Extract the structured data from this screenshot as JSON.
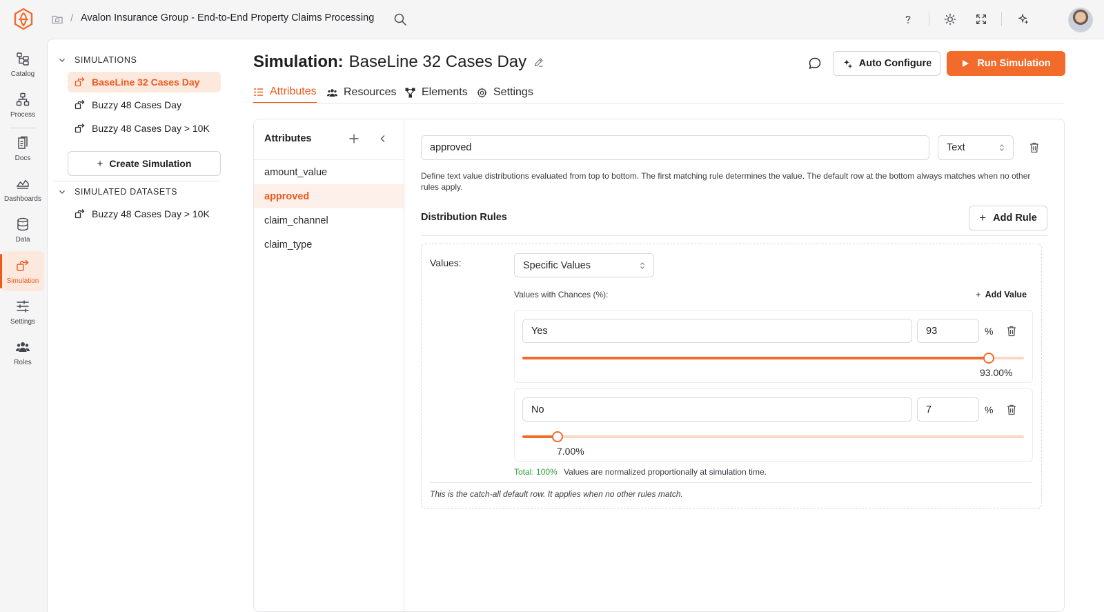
{
  "header": {
    "breadcrumb_title": "Avalon Insurance Group - End-to-End Property Claims Processing",
    "separator": "/"
  },
  "nav": {
    "items": [
      {
        "label": "Catalog",
        "icon": "catalog-icon"
      },
      {
        "label": "Process",
        "icon": "process-icon"
      },
      {
        "label": "Docs",
        "icon": "docs-icon"
      },
      {
        "label": "Dashboards",
        "icon": "dashboards-icon"
      },
      {
        "label": "Data",
        "icon": "database-icon"
      },
      {
        "label": "Simulation",
        "icon": "simulation-icon",
        "active": true
      },
      {
        "label": "Settings",
        "icon": "sliders-icon"
      },
      {
        "label": "Roles",
        "icon": "users-icon"
      }
    ]
  },
  "sidebar": {
    "simulations_heading": "SIMULATIONS",
    "simulations": [
      {
        "label": "BaseLine 32 Cases Day",
        "active": true
      },
      {
        "label": "Buzzy 48 Cases Day"
      },
      {
        "label": "Buzzy 48 Cases Day > 10K"
      }
    ],
    "create_button": "Create Simulation",
    "datasets_heading": "SIMULATED DATASETS",
    "datasets": [
      {
        "label": "Buzzy 48 Cases Day > 10K"
      }
    ]
  },
  "main": {
    "title_prefix": "Simulation:",
    "title_name": "BaseLine 32 Cases Day",
    "auto_configure": "Auto Configure",
    "run_simulation": "Run Simulation",
    "tabs": [
      {
        "label": "Attributes",
        "active": true
      },
      {
        "label": "Resources"
      },
      {
        "label": "Elements"
      },
      {
        "label": "Settings"
      }
    ]
  },
  "attributes": {
    "heading": "Attributes",
    "items": [
      {
        "label": "amount_value"
      },
      {
        "label": "approved",
        "active": true
      },
      {
        "label": "claim_channel"
      },
      {
        "label": "claim_type"
      }
    ]
  },
  "detail": {
    "name_value": "approved",
    "type_value": "Text",
    "description": "Define text value distributions evaluated from top to bottom. The first matching rule determines the value. The default row at the bottom always matches when no other rules apply.",
    "rules_heading": "Distribution Rules",
    "add_rule": "Add Rule",
    "values_label": "Values:",
    "values_mode": "Specific Values",
    "chances_label": "Values with Chances (%):",
    "add_value": "Add Value",
    "values": [
      {
        "text": "Yes",
        "chance": "93",
        "chance_fraction": 0.93,
        "pct_label": "93.00%"
      },
      {
        "text": "No",
        "chance": "7",
        "chance_fraction": 0.07,
        "pct_label": "7.00%"
      }
    ],
    "percent_sign": "%",
    "total_label": "Total: 100%",
    "normalize_note": "Values are normalized proportionally at simulation time.",
    "catch_all_note": "This is the catch-all default row. It applies when no other rules match."
  },
  "colors": {
    "accent": "#f26b2a",
    "accent_soft": "#fde8de",
    "success": "#2e9e3b"
  }
}
